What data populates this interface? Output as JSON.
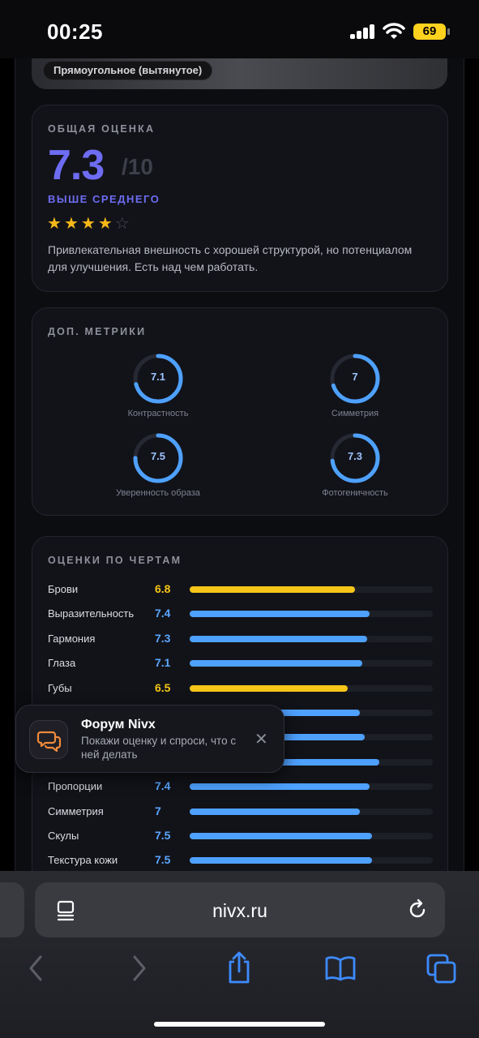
{
  "status": {
    "time": "00:25",
    "battery": "69"
  },
  "hero": {
    "chip": "Прямоугольное (вытянутое)"
  },
  "overall": {
    "title": "ОБЩАЯ ОЦЕНКА",
    "score": "7.3",
    "max": "/10",
    "verdict": "ВЫШЕ СРЕДНЕГО",
    "stars_filled": 4,
    "stars_total": 5,
    "description": "Привлекательная внешность с хорошей структурой, но потенциалом для улучшения. Есть над чем работать."
  },
  "metrics": {
    "title": "ДОП. МЕТРИКИ",
    "items": [
      {
        "label": "Контрастность",
        "value": "7.1",
        "fraction": 0.71
      },
      {
        "label": "Симметрия",
        "value": "7",
        "fraction": 0.7
      },
      {
        "label": "Уверенность образа",
        "value": "7.5",
        "fraction": 0.75
      },
      {
        "label": "Фотогеничность",
        "value": "7.3",
        "fraction": 0.73
      }
    ]
  },
  "traits": {
    "title": "ОЦЕНКИ ПО ЧЕРТАМ",
    "items": [
      {
        "label": "Брови",
        "value": "6.8",
        "fraction": 0.68,
        "color": "yellow"
      },
      {
        "label": "Выразительность",
        "value": "7.4",
        "fraction": 0.74,
        "color": "blue"
      },
      {
        "label": "Гармония",
        "value": "7.3",
        "fraction": 0.73,
        "color": "blue"
      },
      {
        "label": "Глаза",
        "value": "7.1",
        "fraction": 0.71,
        "color": "blue"
      },
      {
        "label": "Губы",
        "value": "6.5",
        "fraction": 0.65,
        "color": "yellow"
      },
      {
        "label": "",
        "value": "",
        "fraction": 0.7,
        "color": "blue"
      },
      {
        "label": "",
        "value": "",
        "fraction": 0.72,
        "color": "blue"
      },
      {
        "label": "",
        "value": "",
        "fraction": 0.78,
        "color": "blue"
      },
      {
        "label": "Пропорции",
        "value": "7.4",
        "fraction": 0.74,
        "color": "blue"
      },
      {
        "label": "Симметрия",
        "value": "7",
        "fraction": 0.7,
        "color": "blue"
      },
      {
        "label": "Скулы",
        "value": "7.5",
        "fraction": 0.75,
        "color": "blue"
      },
      {
        "label": "Текстура кожи",
        "value": "7.5",
        "fraction": 0.75,
        "color": "blue"
      }
    ]
  },
  "toast": {
    "title": "Форум Nivx",
    "text": "Покажи оценку и спроси, что с ней делать",
    "icon": "chat-bubbles-icon"
  },
  "browser": {
    "url": "nivx.ru"
  },
  "colors": {
    "accent": "#6d6cf2",
    "blue": "#4ea1ff",
    "yellow": "#f5c518",
    "icon_blue": "#3d8bff"
  }
}
